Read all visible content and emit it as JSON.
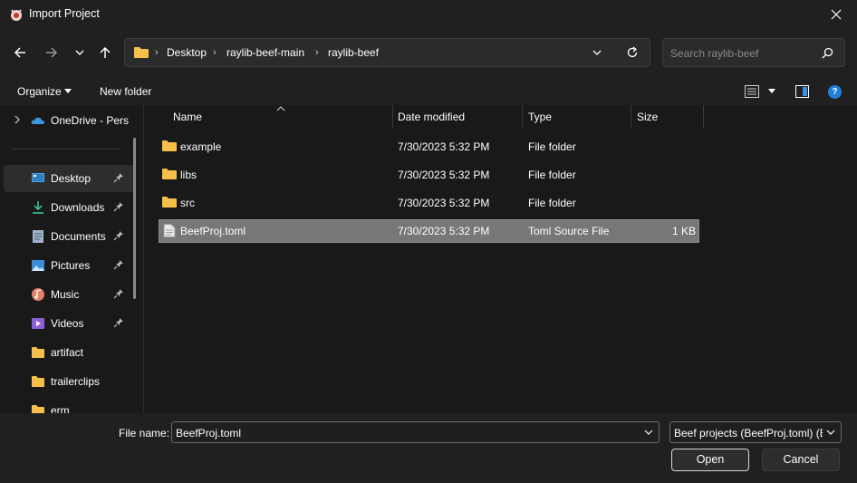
{
  "window": {
    "title": "Import Project",
    "app_icon": "beef-logo-icon",
    "close_icon": "close-icon"
  },
  "nav": {
    "back_icon": "arrow-left-icon",
    "forward_icon": "arrow-right-icon",
    "recent_icon": "chevron-down-icon",
    "up_icon": "arrow-up-icon"
  },
  "address": {
    "crumbs": [
      "Desktop",
      "raylib-beef-main",
      "raylib-beef"
    ]
  },
  "search": {
    "placeholder": "Search raylib-beef"
  },
  "commands": {
    "organize": "Organize",
    "new_folder": "New folder",
    "help": "?"
  },
  "sidebar": {
    "items": [
      {
        "label": "OneDrive - Pers",
        "icon": "onedrive-icon",
        "pinned": false,
        "active": false
      },
      {
        "label": "Desktop",
        "icon": "desktop-icon",
        "pinned": true,
        "active": true
      },
      {
        "label": "Downloads",
        "icon": "download-icon",
        "pinned": true,
        "active": false
      },
      {
        "label": "Documents",
        "icon": "documents-icon",
        "pinned": true,
        "active": false
      },
      {
        "label": "Pictures",
        "icon": "pictures-icon",
        "pinned": true,
        "active": false
      },
      {
        "label": "Music",
        "icon": "music-icon",
        "pinned": true,
        "active": false
      },
      {
        "label": "Videos",
        "icon": "videos-icon",
        "pinned": true,
        "active": false
      },
      {
        "label": "artifact",
        "icon": "folder-icon",
        "pinned": false,
        "active": false
      },
      {
        "label": "trailerclips",
        "icon": "folder-icon",
        "pinned": false,
        "active": false
      },
      {
        "label": "erm",
        "icon": "folder-icon",
        "pinned": false,
        "active": false
      }
    ]
  },
  "files": {
    "columns": {
      "name": "Name",
      "date": "Date modified",
      "type": "Type",
      "size": "Size"
    },
    "rows": [
      {
        "name": "example",
        "date": "7/30/2023 5:32 PM",
        "type": "File folder",
        "size": "",
        "icon": "folder-icon",
        "selected": false
      },
      {
        "name": "libs",
        "date": "7/30/2023 5:32 PM",
        "type": "File folder",
        "size": "",
        "icon": "folder-icon",
        "selected": false
      },
      {
        "name": "src",
        "date": "7/30/2023 5:32 PM",
        "type": "File folder",
        "size": "",
        "icon": "folder-icon",
        "selected": false
      },
      {
        "name": "BeefProj.toml",
        "date": "7/30/2023 5:32 PM",
        "type": "Toml Source File",
        "size": "1 KB",
        "icon": "file-icon",
        "selected": true
      }
    ]
  },
  "footer": {
    "file_name_label": "File name:",
    "file_name_value": "BeefProj.toml",
    "file_type_value": "Beef projects (BeefProj.toml) (B",
    "open": "Open",
    "cancel": "Cancel"
  },
  "colors": {
    "folder": "#f5c04a",
    "accent": "#1f7fd6",
    "selection": "#777777"
  }
}
